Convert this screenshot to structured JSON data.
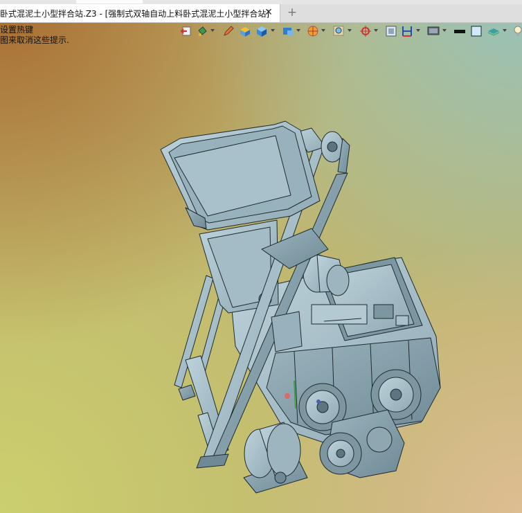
{
  "window": {
    "tab_title": "卧式混泥土小型拌合站.Z3 - [强制式双轴自动上料卧式混泥土小型拌合站]",
    "close_symbol": "✕",
    "new_tab_symbol": "+"
  },
  "hints": {
    "line1": "设置热键",
    "line2": "图来取消这些提示."
  },
  "toolbar": {
    "icons": [
      "exit-icon",
      "paint-bucket-icon",
      "pencil-icon",
      "box-color-icon",
      "cube-icon",
      "cube-view-icon",
      "section-view-icon",
      "zoom-icon",
      "target-icon",
      "frame-icon",
      "dimension-icon",
      "display-icon",
      "black-line-icon",
      "white-box-icon",
      "layer-icon",
      "lightbulb-icon"
    ]
  },
  "viewport": {
    "background_colors": [
      "#a86c30",
      "#bfb670",
      "#96c3be",
      "#e1be96"
    ],
    "model_color": "#a8c2cc",
    "model_line_color": "#1e2a30"
  }
}
